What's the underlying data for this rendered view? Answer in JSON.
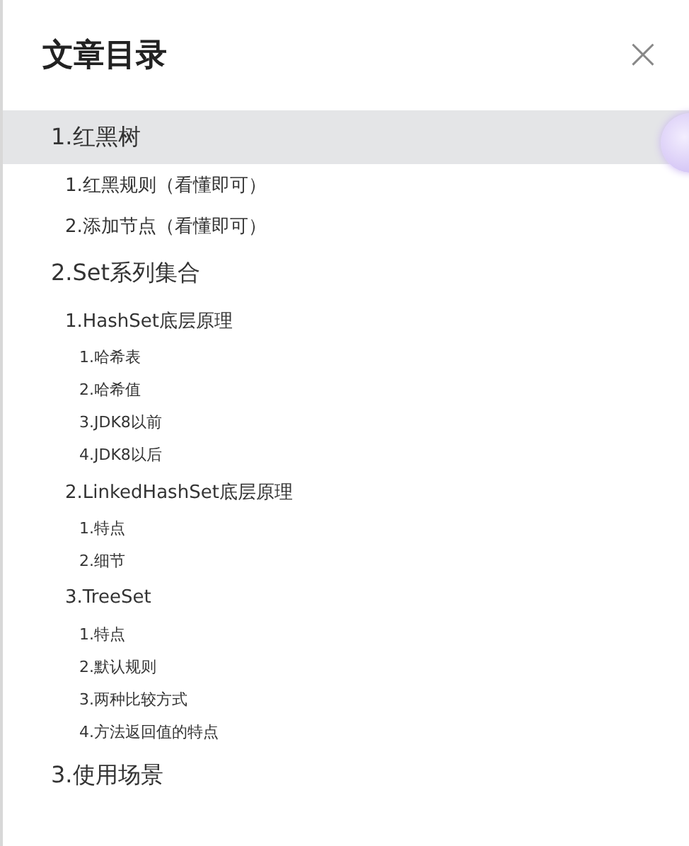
{
  "panel": {
    "title": "文章目录",
    "close_label": "×"
  },
  "toc": [
    {
      "text": "1.红黑树",
      "selected": true,
      "children": [
        {
          "text": "1.红黑规则（看懂即可）",
          "selected": false
        },
        {
          "text": "2.添加节点（看懂即可）",
          "selected": false
        }
      ]
    },
    {
      "text": "2.Set系列集合",
      "selected": false,
      "children": [
        {
          "text": "1.HashSet底层原理",
          "selected": false,
          "children": [
            {
              "text": "1.哈希表",
              "selected": false
            },
            {
              "text": "2.哈希值",
              "selected": false
            },
            {
              "text": "3.JDK8以前",
              "selected": false
            },
            {
              "text": "4.JDK8以后",
              "selected": false
            }
          ]
        },
        {
          "text": "2.LinkedHashSet底层原理",
          "selected": false,
          "children": [
            {
              "text": "1.特点",
              "selected": false
            },
            {
              "text": "2.细节",
              "selected": false
            }
          ]
        },
        {
          "text": "3.TreeSet",
          "selected": false,
          "children": [
            {
              "text": "1.特点",
              "selected": false
            },
            {
              "text": "2.默认规则",
              "selected": false
            },
            {
              "text": "3.两种比较方式",
              "selected": false
            },
            {
              "text": "4.方法返回值的特点",
              "selected": false
            }
          ]
        }
      ]
    },
    {
      "text": "3.使用场景",
      "selected": false
    }
  ]
}
